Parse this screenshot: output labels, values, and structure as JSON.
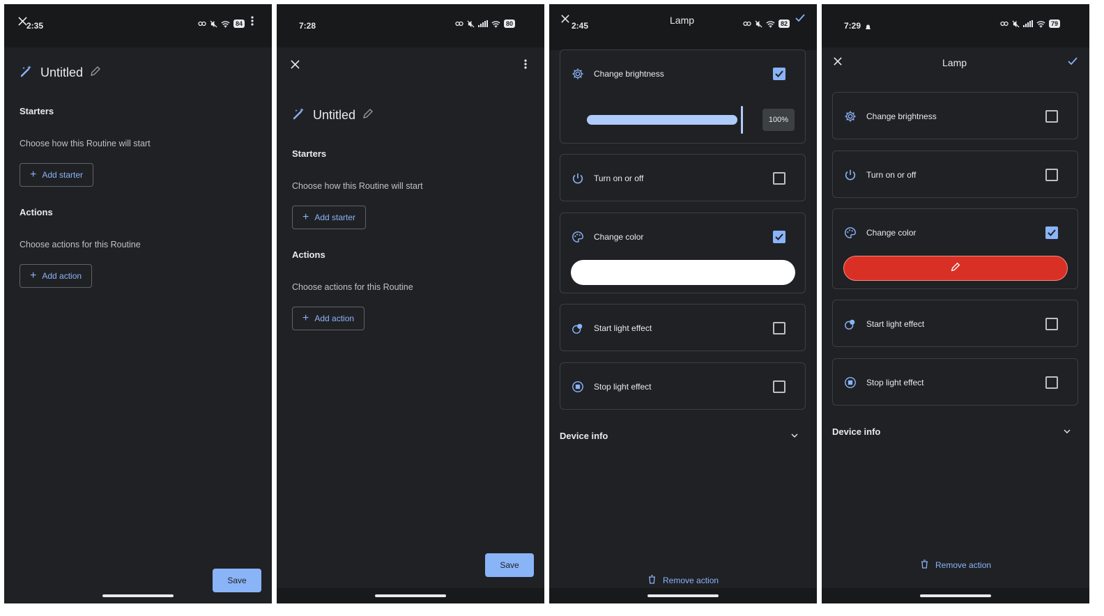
{
  "colors": {
    "background": "#202124",
    "status_bar": "#18191b",
    "accent": "#8ab4f8",
    "text": "#e8eaed",
    "subtext": "#bdc1c6",
    "selected_color": "#d93025",
    "white_color": "#ffffff"
  },
  "screen1": {
    "status_time": "2:35",
    "battery": "84",
    "routine_title": "Untitled",
    "starters_heading": "Starters",
    "starters_sub": "Choose how this Routine will start",
    "add_starter": "Add starter",
    "actions_heading": "Actions",
    "actions_sub": "Choose actions for this Routine",
    "add_action": "Add action",
    "save": "Save"
  },
  "screen2": {
    "status_time": "7:28",
    "battery": "80",
    "routine_title": "Untitled",
    "starters_heading": "Starters",
    "starters_sub": "Choose how this Routine will start",
    "add_starter": "Add starter",
    "actions_heading": "Actions",
    "actions_sub": "Choose actions for this Routine",
    "add_action": "Add action",
    "save": "Save"
  },
  "screen3": {
    "status_time": "2:45",
    "battery": "82",
    "title": "Lamp",
    "items": [
      {
        "label": "Change brightness",
        "icon": "gear-icon",
        "checked": true
      },
      {
        "label": "Turn on or off",
        "icon": "power-icon",
        "checked": false
      },
      {
        "label": "Change color",
        "icon": "palette-icon",
        "checked": true
      },
      {
        "label": "Start light effect",
        "icon": "light-effect-icon",
        "checked": false
      },
      {
        "label": "Stop light effect",
        "icon": "stop-icon",
        "checked": false
      }
    ],
    "brightness_percent": "100%",
    "brightness_level": 1.0,
    "device_info": "Device info",
    "remove_action": "Remove action"
  },
  "screen4": {
    "status_time": "7:29",
    "battery": "79",
    "title": "Lamp",
    "items": [
      {
        "label": "Change brightness",
        "icon": "gear-icon",
        "checked": false
      },
      {
        "label": "Turn on or off",
        "icon": "power-icon",
        "checked": false
      },
      {
        "label": "Change color",
        "icon": "palette-icon",
        "checked": true
      },
      {
        "label": "Start light effect",
        "icon": "light-effect-icon",
        "checked": false
      },
      {
        "label": "Stop light effect",
        "icon": "stop-icon",
        "checked": false
      }
    ],
    "device_info": "Device info",
    "remove_action": "Remove action"
  }
}
